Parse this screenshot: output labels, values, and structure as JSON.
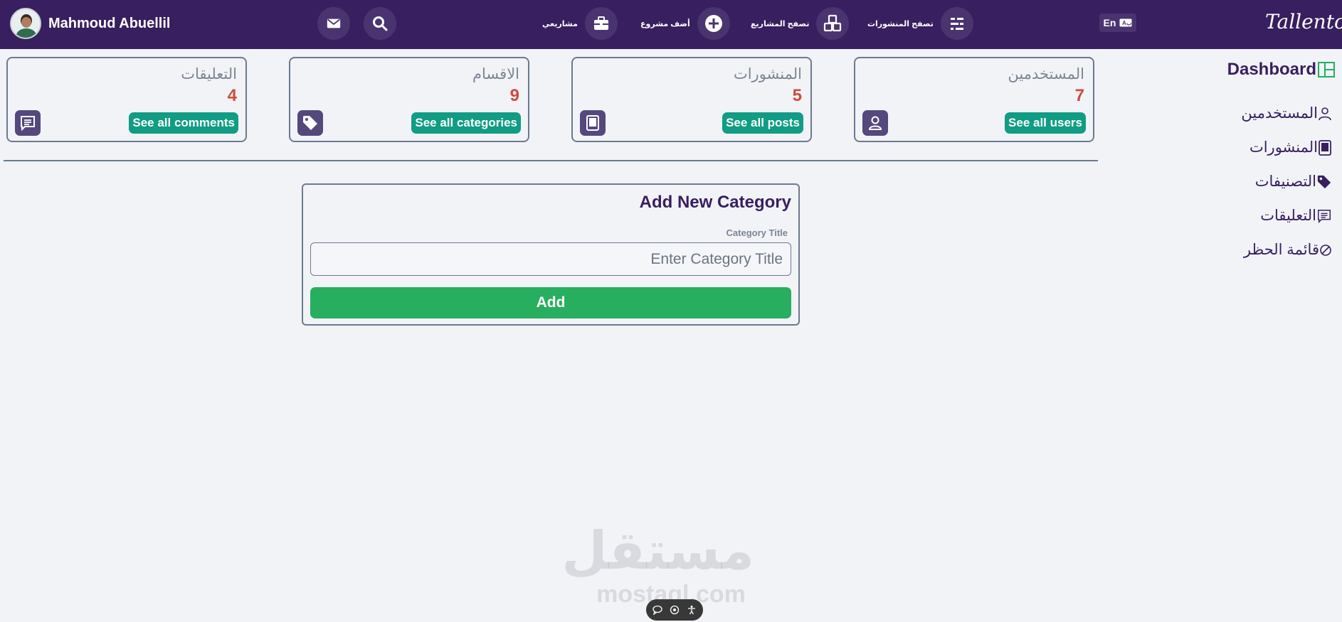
{
  "header": {
    "user_name": "Mahmoud Abuellil",
    "nav": {
      "my_projects": "مشاريعي",
      "add_project": "أضف مشروع",
      "browse_projects": "تصفح المشاريع",
      "browse_posts": "تصفح المنشورات"
    },
    "lang_label": "En",
    "logo": "Tallento"
  },
  "stats": [
    {
      "title": "التعليقات",
      "count": "4",
      "link": "See all comments",
      "icon": "comment-icon"
    },
    {
      "title": "الاقسام",
      "count": "9",
      "link": "See all categories",
      "icon": "tag-icon"
    },
    {
      "title": "المنشورات",
      "count": "5",
      "link": "See all posts",
      "icon": "post-icon"
    },
    {
      "title": "المستخدمين",
      "count": "7",
      "link": "See all users",
      "icon": "user-icon"
    }
  ],
  "sidebar": {
    "title": "Dashboard",
    "items": [
      {
        "label": "المستخدمين",
        "icon": "user-icon"
      },
      {
        "label": "المنشورات",
        "icon": "post-icon"
      },
      {
        "label": "التصنيفات",
        "icon": "tag-icon"
      },
      {
        "label": "التعليقات",
        "icon": "comment-icon"
      },
      {
        "label": "قائمة الحظر",
        "icon": "block-icon"
      }
    ]
  },
  "form": {
    "title": "Add New Category",
    "field_label": "Category Title",
    "placeholder": "Enter Category Title",
    "value": "",
    "submit_label": "Add"
  },
  "watermark": {
    "arabic": "مستقل",
    "latin": "mostaql.com"
  },
  "colors": {
    "header_bg": "#381f5f",
    "accent_teal": "#119c84",
    "accent_green": "#27ae5f",
    "count_red": "#d04a3e",
    "icon_tile": "#54487c"
  }
}
